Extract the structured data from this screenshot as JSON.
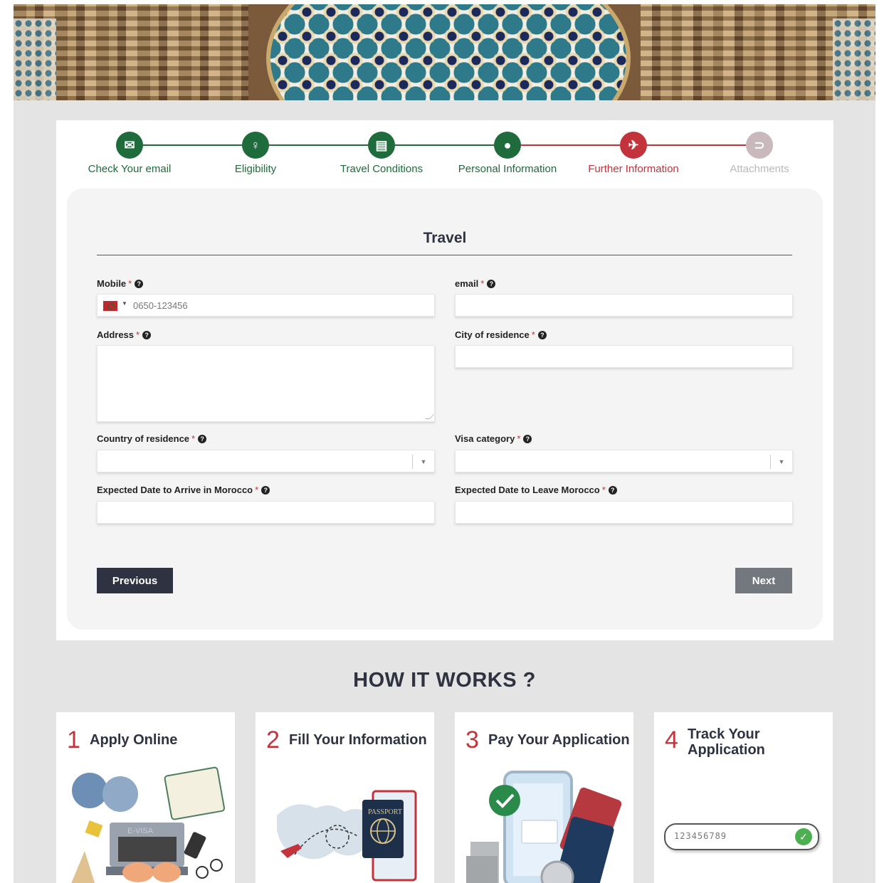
{
  "steps": [
    {
      "label": "Check Your email",
      "icon": "envelope-icon",
      "state": "done"
    },
    {
      "label": "Eligibility",
      "icon": "eligibility-icon",
      "state": "done"
    },
    {
      "label": "Travel Conditions",
      "icon": "document-icon",
      "state": "done"
    },
    {
      "label": "Personal Information",
      "icon": "user-icon",
      "state": "done"
    },
    {
      "label": "Further Information",
      "icon": "airplane-icon",
      "state": "current"
    },
    {
      "label": "Attachments",
      "icon": "paperclip-icon",
      "state": "todo"
    }
  ],
  "form": {
    "title": "Travel",
    "required_mark": "*",
    "mobile": {
      "label": "Mobile",
      "placeholder": "0650-123456"
    },
    "email": {
      "label": "email"
    },
    "address": {
      "label": "Address"
    },
    "city": {
      "label": "City of residence"
    },
    "country": {
      "label": "Country of residence"
    },
    "visa": {
      "label": "Visa category"
    },
    "arrive": {
      "label": "Expected Date to Arrive in Morocco"
    },
    "leave": {
      "label": "Expected Date to Leave Morocco"
    },
    "previous_label": "Previous",
    "next_label": "Next"
  },
  "how": {
    "title": "HOW IT WORKS ?",
    "cards": [
      {
        "num": "1",
        "text": "Apply Online"
      },
      {
        "num": "2",
        "text": "Fill Your Information"
      },
      {
        "num": "3",
        "text": "Pay Your Application"
      },
      {
        "num": "4",
        "text": "Track Your Application"
      }
    ],
    "track_value": "123456789",
    "illus_evisa": "E-VISA",
    "illus_passport": "PASSPORT"
  },
  "colors": {
    "done": "#1e6b3c",
    "current": "#c3333b",
    "todo": "#c9b9bd",
    "dark": "#2f3240"
  }
}
